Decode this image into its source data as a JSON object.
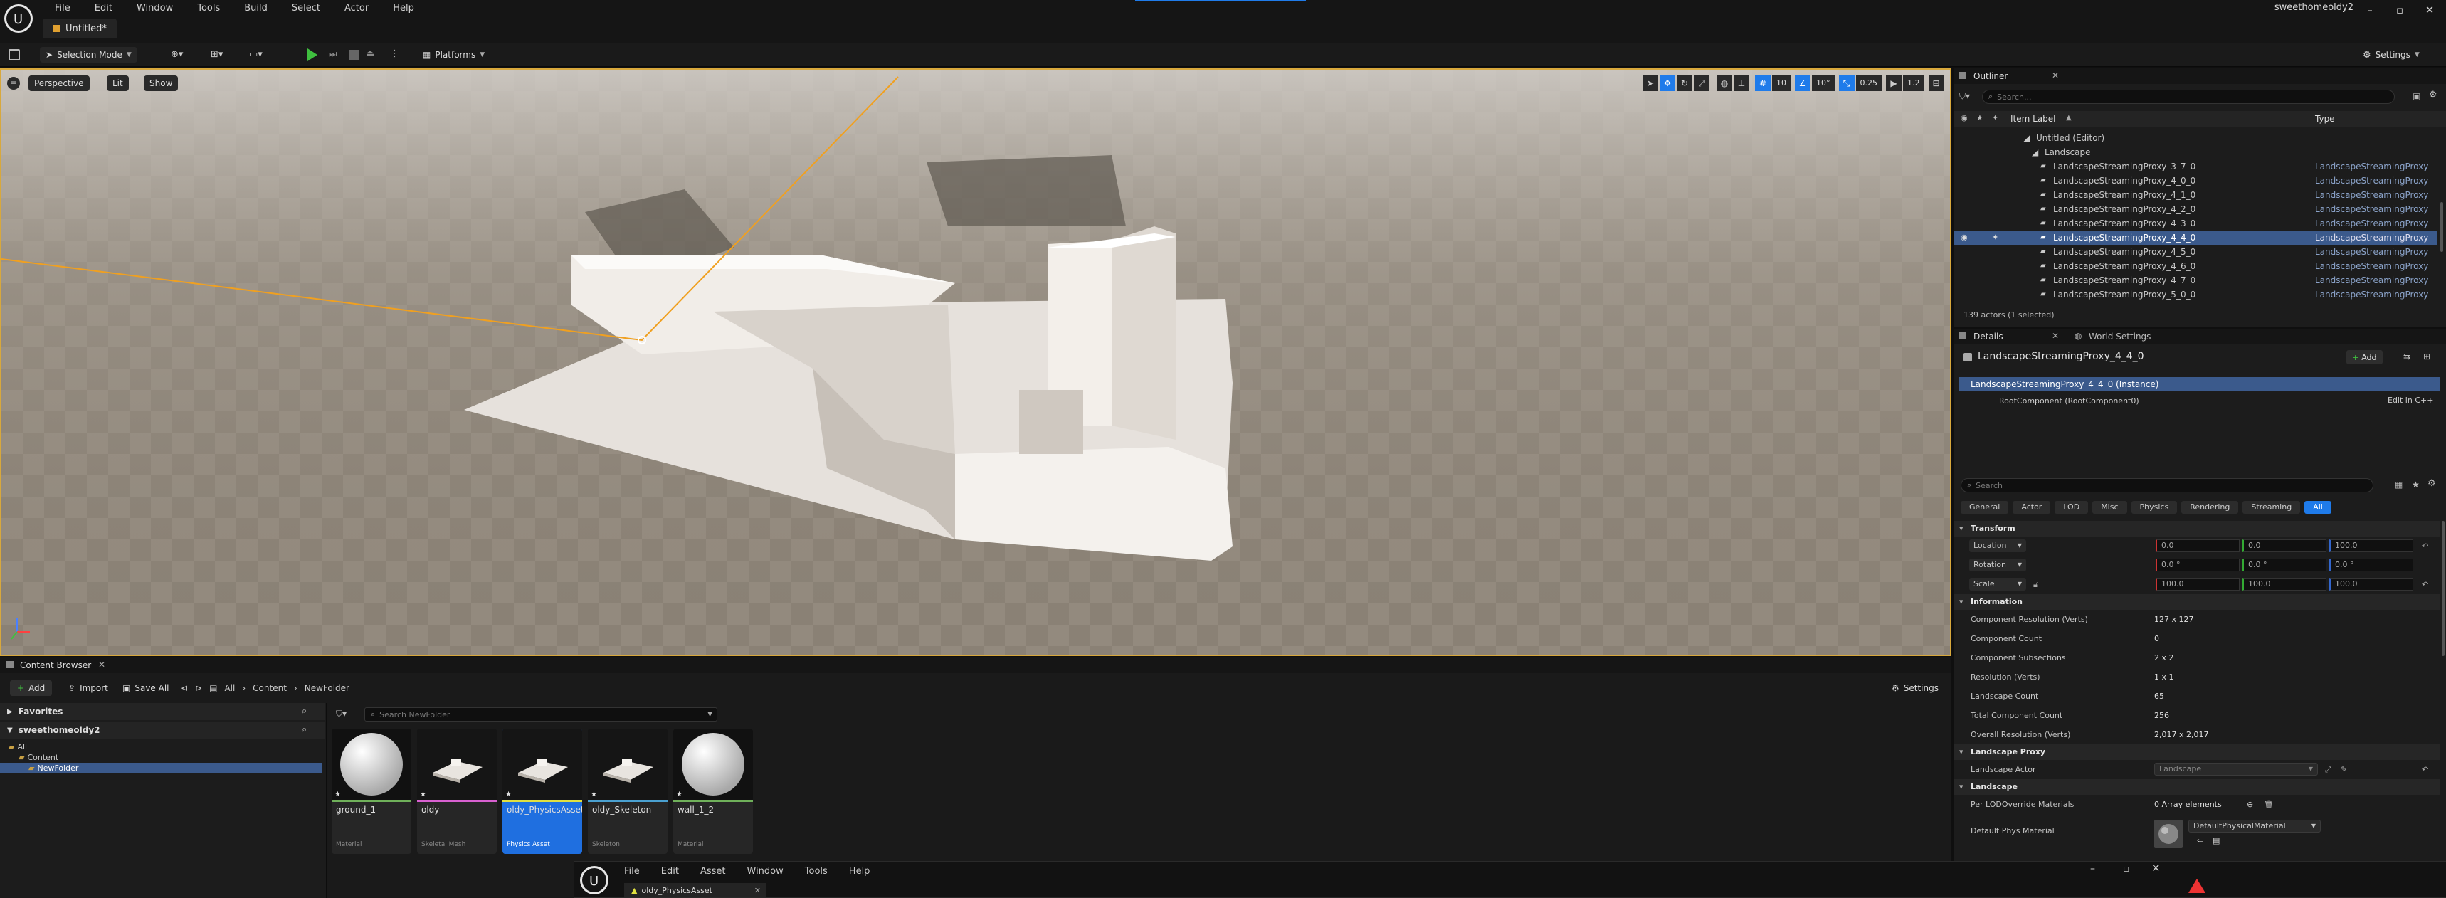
{
  "menubar": {
    "items": [
      "File",
      "Edit",
      "Window",
      "Tools",
      "Build",
      "Select",
      "Actor",
      "Help"
    ]
  },
  "doc_tab": {
    "title": "Untitled*"
  },
  "user": {
    "name": "sweethomeoldy2"
  },
  "toolbar": {
    "mode": "Selection Mode",
    "platforms": "Platforms",
    "settings": "Settings"
  },
  "viewport": {
    "perspective": "Perspective",
    "lit": "Lit",
    "show": "Show",
    "grid_snap": "10",
    "rot_snap": "10°",
    "scale_snap": "0.25",
    "cam_speed": "1.2"
  },
  "outliner": {
    "tab": "Outliner",
    "search_placeholder": "Search...",
    "col_label": "Item Label",
    "col_type": "Type",
    "world": "Untitled (Editor)",
    "folder": "Landscape",
    "rows": [
      {
        "label": "LandscapeStreamingProxy_3_7_0",
        "type": "LandscapeStreamingProxy"
      },
      {
        "label": "LandscapeStreamingProxy_4_0_0",
        "type": "LandscapeStreamingProxy"
      },
      {
        "label": "LandscapeStreamingProxy_4_1_0",
        "type": "LandscapeStreamingProxy"
      },
      {
        "label": "LandscapeStreamingProxy_4_2_0",
        "type": "LandscapeStreamingProxy"
      },
      {
        "label": "LandscapeStreamingProxy_4_3_0",
        "type": "LandscapeStreamingProxy"
      },
      {
        "label": "LandscapeStreamingProxy_4_4_0",
        "type": "LandscapeStreamingProxy"
      },
      {
        "label": "LandscapeStreamingProxy_4_5_0",
        "type": "LandscapeStreamingProxy"
      },
      {
        "label": "LandscapeStreamingProxy_4_6_0",
        "type": "LandscapeStreamingProxy"
      },
      {
        "label": "LandscapeStreamingProxy_4_7_0",
        "type": "LandscapeStreamingProxy"
      },
      {
        "label": "LandscapeStreamingProxy_5_0_0",
        "type": "LandscapeStreamingProxy"
      }
    ],
    "status": "139 actors (1 selected)"
  },
  "details": {
    "tab": "Details",
    "tab2": "World Settings",
    "actor_name": "LandscapeStreamingProxy_4_4_0",
    "add": "Add",
    "instance": "LandscapeStreamingProxy_4_4_0 (Instance)",
    "root_component": "RootComponent (RootComponent0)",
    "edit_cpp": "Edit in C++",
    "search_placeholder": "Search",
    "filters": [
      "General",
      "Actor",
      "LOD",
      "Misc",
      "Physics",
      "Rendering",
      "Streaming",
      "All"
    ],
    "transform": {
      "header": "Transform",
      "location": "Location",
      "rotation": "Rotation",
      "scale": "Scale",
      "loc": [
        "0.0",
        "0.0",
        "100.0"
      ],
      "rot": [
        "0.0 °",
        "0.0 °",
        "0.0 °"
      ],
      "scl": [
        "100.0",
        "100.0",
        "100.0"
      ]
    },
    "information": {
      "header": "Information",
      "rows": [
        {
          "label": "Component Resolution (Verts)",
          "value": "127 x 127"
        },
        {
          "label": "Component Count",
          "value": "0"
        },
        {
          "label": "Component Subsections",
          "value": "2 x 2"
        },
        {
          "label": "Resolution (Verts)",
          "value": "1 x 1"
        },
        {
          "label": "Landscape Count",
          "value": "65"
        },
        {
          "label": "Total Component Count",
          "value": "256"
        },
        {
          "label": "Overall Resolution (Verts)",
          "value": "2,017 x 2,017"
        }
      ]
    },
    "landscape_proxy": {
      "header": "Landscape Proxy",
      "actor_label": "Landscape Actor",
      "actor_value": "Landscape"
    },
    "landscape": {
      "header": "Landscape",
      "lod_label": "Per LODOverride Materials",
      "lod_value": "0 Array elements",
      "phys_label": "Default Phys Material",
      "phys_value": "DefaultPhysicalMaterial"
    }
  },
  "content_browser": {
    "tab": "Content Browser",
    "add": "Add",
    "import": "Import",
    "save_all": "Save All",
    "path": [
      "All",
      "Content",
      "NewFolder"
    ],
    "settings": "Settings",
    "search_placeholder": "Search NewFolder",
    "favorites": "Favorites",
    "project": "sweethomeoldy2",
    "tree": [
      "All",
      "Content",
      "NewFolder"
    ],
    "assets": [
      {
        "name": "ground_1",
        "type": "Material",
        "color": "#6fb05a"
      },
      {
        "name": "oldy",
        "type": "Skeletal Mesh",
        "color": "#d860d0"
      },
      {
        "name": "oldy_PhysicsAsset",
        "type": "Physics Asset",
        "color": "#e0e040"
      },
      {
        "name": "oldy_Skeleton",
        "type": "Skeleton",
        "color": "#4aa0d0"
      },
      {
        "name": "wall_1_2",
        "type": "Material",
        "color": "#6fb05a"
      }
    ]
  },
  "second_window": {
    "menu": [
      "File",
      "Edit",
      "Asset",
      "Window",
      "Tools",
      "Help"
    ],
    "tab": "oldy_PhysicsAsset"
  }
}
